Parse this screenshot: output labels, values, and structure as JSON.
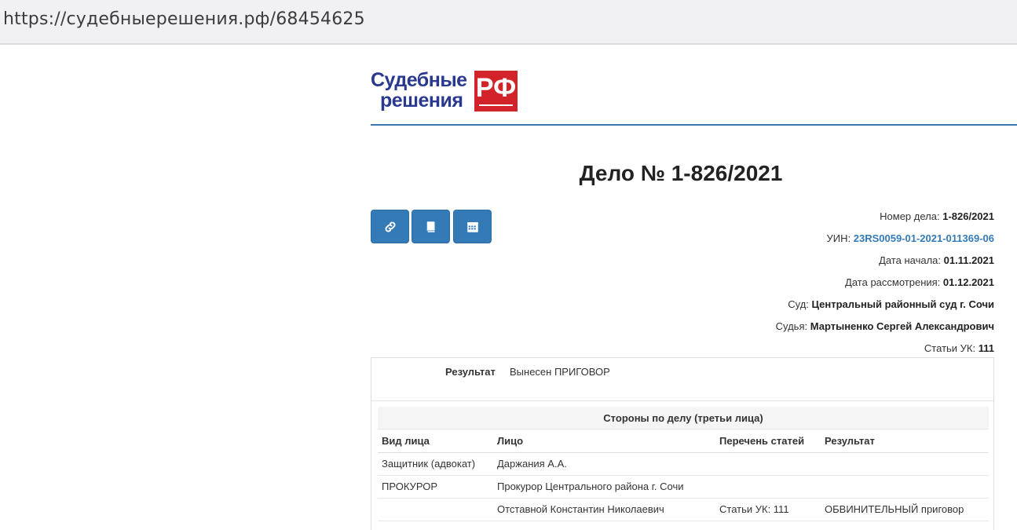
{
  "browser": {
    "url": "https://судебныерешения.рф/68454625"
  },
  "logo": {
    "word1": "Судебные",
    "word2": "решения",
    "mark": "РФ"
  },
  "page": {
    "title": "Дело № 1-826/2021"
  },
  "toolbar": {
    "buttons": [
      {
        "icon": "link-icon"
      },
      {
        "icon": "book-icon"
      },
      {
        "icon": "calendar-icon"
      }
    ]
  },
  "case_info": {
    "number_label": "Номер дела:",
    "number": "1-826/2021",
    "uin_label": "УИН:",
    "uin": "23RS0059-01-2021-011369-06",
    "start_label": "Дата начала:",
    "start": "01.11.2021",
    "review_label": "Дата рассмотрения:",
    "review": "01.12.2021",
    "court_label": "Суд:",
    "court": "Центральный районный суд г. Сочи",
    "judge_label": "Судья:",
    "judge": "Мартыненко Сергей Александрович",
    "articles_label": "Статьи УК:",
    "articles": "111"
  },
  "result": {
    "label": "Результат",
    "value": "Вынесен ПРИГОВОР"
  },
  "parties": {
    "caption": "Стороны по делу (третьи лица)",
    "headers": [
      "Вид лица",
      "Лицо",
      "Перечень статей",
      "Результат"
    ],
    "rows": [
      [
        "Защитник (адвокат)",
        "Даржания А.А.",
        "",
        ""
      ],
      [
        "ПРОКУРОР",
        "Прокурор Центрального района г. Сочи",
        "",
        ""
      ],
      [
        "",
        "Отставной Константин Николаевич",
        "Статьи УК: 111",
        "ОБВИНИТЕЛЬНЫЙ приговор"
      ]
    ]
  },
  "colors": {
    "accent": "#337ab7",
    "brand_blue": "#28398f",
    "brand_red": "#d2232a"
  }
}
